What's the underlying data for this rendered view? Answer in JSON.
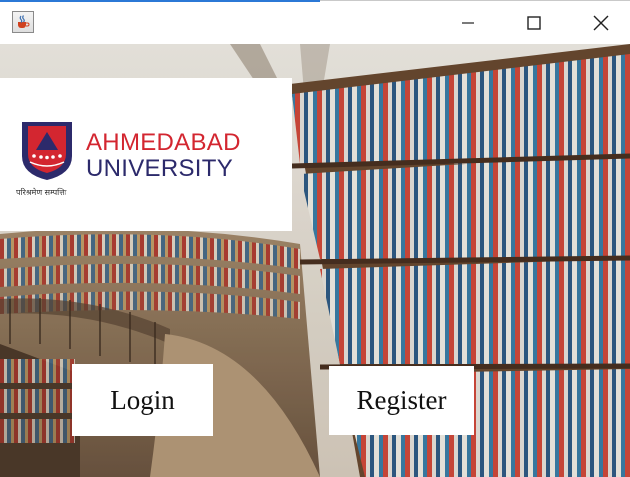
{
  "window": {
    "title": "",
    "icon": "java-cup-icon",
    "controls": [
      "minimize",
      "maximize",
      "close"
    ]
  },
  "logo": {
    "line1": "AHMEDABAD",
    "line2": "UNIVERSITY",
    "motto": "परिश्रमेण सम्पत्तिः",
    "colors": {
      "red": "#d32630",
      "navy": "#2c2a6b"
    }
  },
  "background": {
    "description_icon": "library-bookshelves-image"
  },
  "buttons": {
    "login": "Login",
    "register": "Register"
  }
}
